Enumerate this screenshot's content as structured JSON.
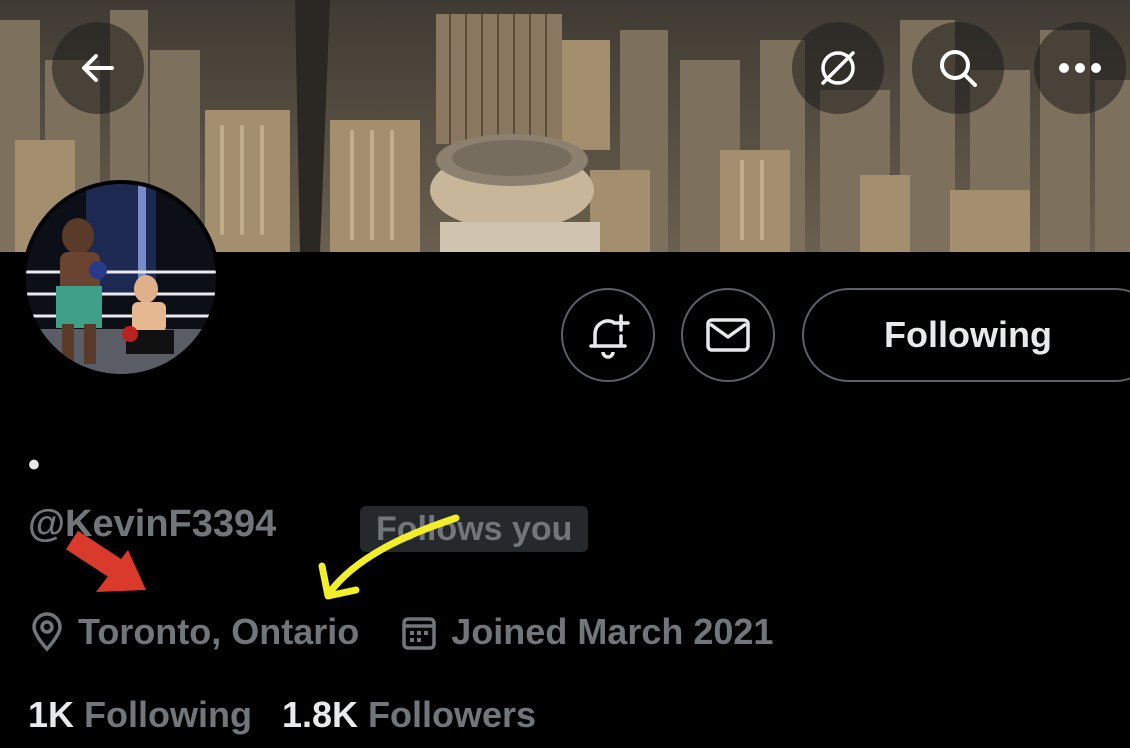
{
  "header": {
    "back_icon": "arrow-left-icon",
    "actions": [
      "translate-off-icon",
      "search-icon",
      "more-icon"
    ]
  },
  "profile": {
    "display_name": "•",
    "handle": "@KevinF3394",
    "follows_you_badge": "Follows you",
    "location": "Toronto, Ontario",
    "joined": "Joined March 2021",
    "following_count": "1K",
    "following_label": "Following",
    "followers_count": "1.8K",
    "followers_label": "Followers"
  },
  "actions": {
    "notify_icon": "bell-plus-icon",
    "message_icon": "envelope-icon",
    "following_button": "Following"
  },
  "annotations": {
    "red_arrow_color": "#d93a2b",
    "yellow_arrow_color": "#f2ef2a"
  },
  "colors": {
    "background": "#000000",
    "text_primary": "#e7e9ea",
    "text_secondary": "#71767b",
    "border": "#5b6167"
  }
}
